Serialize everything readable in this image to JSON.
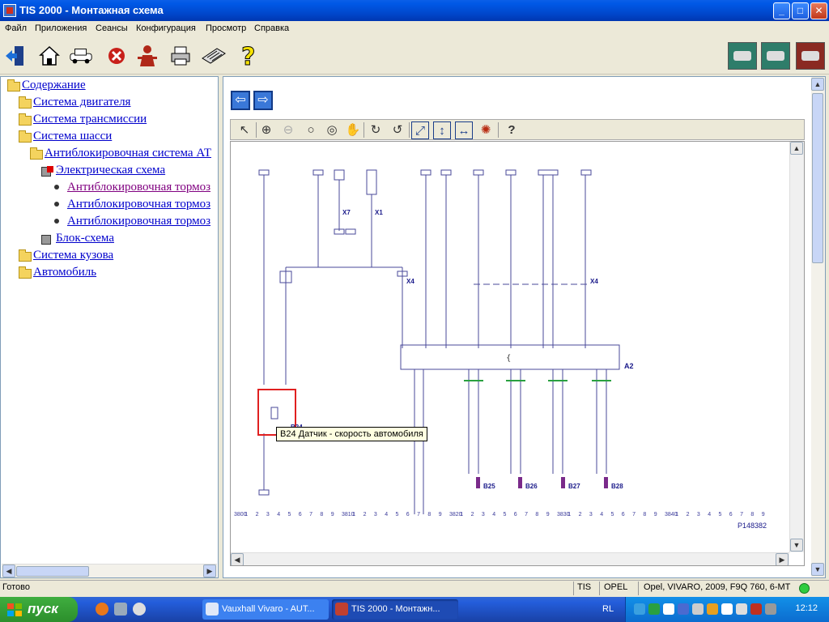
{
  "window": {
    "title": "TIS 2000 - Монтажная схема",
    "min_glyph": "_",
    "max_glyph": "□",
    "close_glyph": "✕"
  },
  "menu": [
    "Файл",
    "Приложения",
    "Сеансы",
    "Конфигурация",
    "Просмотр",
    "Справка"
  ],
  "toolbar_icons": [
    "exit-icon",
    "home-icon",
    "vehicle-icon",
    "stop-icon",
    "person-icon",
    "printer-icon",
    "keyboard-icon",
    "help-icon"
  ],
  "toolbar_right_icons": [
    "vehicle-list-icon",
    "vehicle-front-icon",
    "vehicle-red-icon"
  ],
  "tree": {
    "items": [
      {
        "label": "Содержание",
        "icon": "folder-open-icon",
        "visited": false
      },
      {
        "label": "Система двигателя",
        "icon": "folder-icon",
        "visited": false
      },
      {
        "label": "Система трансмиссии",
        "icon": "folder-icon",
        "visited": false
      },
      {
        "label": "Система шасси",
        "icon": "folder-open-icon",
        "visited": false
      },
      {
        "label": "Антиблокировочная система АТ",
        "icon": "folder-open-icon",
        "visited": false
      },
      {
        "label": "Электрическая схема",
        "icon": "book-open-icon",
        "visited": false
      },
      {
        "label": "Антиблокировочная тормоз",
        "icon": "bullet-icon",
        "visited": true
      },
      {
        "label": "Антиблокировочная тормоз",
        "icon": "bullet-icon",
        "visited": false
      },
      {
        "label": "Антиблокировочная тормоз",
        "icon": "bullet-icon",
        "visited": false
      },
      {
        "label": "Блок-схема",
        "icon": "book-icon",
        "visited": false
      },
      {
        "label": "Система кузова",
        "icon": "folder-icon",
        "visited": false
      },
      {
        "label": "Автомобиль",
        "icon": "folder-icon",
        "visited": false
      }
    ]
  },
  "viewer_tools": [
    "pointer-icon",
    "zoom-in-icon",
    "zoom-out-icon",
    "zoom-icon",
    "zoom-area-icon",
    "pan-hand-icon",
    "rotate-cw-icon",
    "rotate-ccw-icon",
    "fit-page-icon",
    "fit-height-icon",
    "fit-width-icon",
    "highlight-icon",
    "help-icon"
  ],
  "schematic": {
    "tooltip": "B24 Датчик - скорость автомобиля",
    "component_a2": "A2",
    "connector_x4a": "X4",
    "connector_x4b": "X4",
    "connector_x7": "X7",
    "connector_x1": "X1",
    "sensors": [
      "B25",
      "B26",
      "B27",
      "B28"
    ],
    "sensor_b24": "B24",
    "ruler_ticks": [
      "3800",
      "1",
      "2",
      "3",
      "4",
      "5",
      "6",
      "7",
      "8",
      "9",
      "3810",
      "1",
      "2",
      "3",
      "4",
      "5",
      "6",
      "7",
      "8",
      "9",
      "3820",
      "1",
      "2",
      "3",
      "4",
      "5",
      "6",
      "7",
      "8",
      "9",
      "3830",
      "1",
      "2",
      "3",
      "4",
      "5",
      "6",
      "7",
      "8",
      "9",
      "3840",
      "1",
      "2",
      "3",
      "4",
      "5",
      "6",
      "7",
      "8",
      "9"
    ],
    "page_code": "P148382"
  },
  "status": {
    "text": "Готово",
    "system": "TIS",
    "brand": "OPEL",
    "vehicle": "Opel, VIVARO, 2009, F9Q 760, 6-MT"
  },
  "taskbar": {
    "start": "пуск",
    "tasks": [
      "Vauxhall Vivaro - AUT...",
      "TIS 2000 - Монтажн..."
    ],
    "lang": "RL",
    "clock": "12:12"
  }
}
